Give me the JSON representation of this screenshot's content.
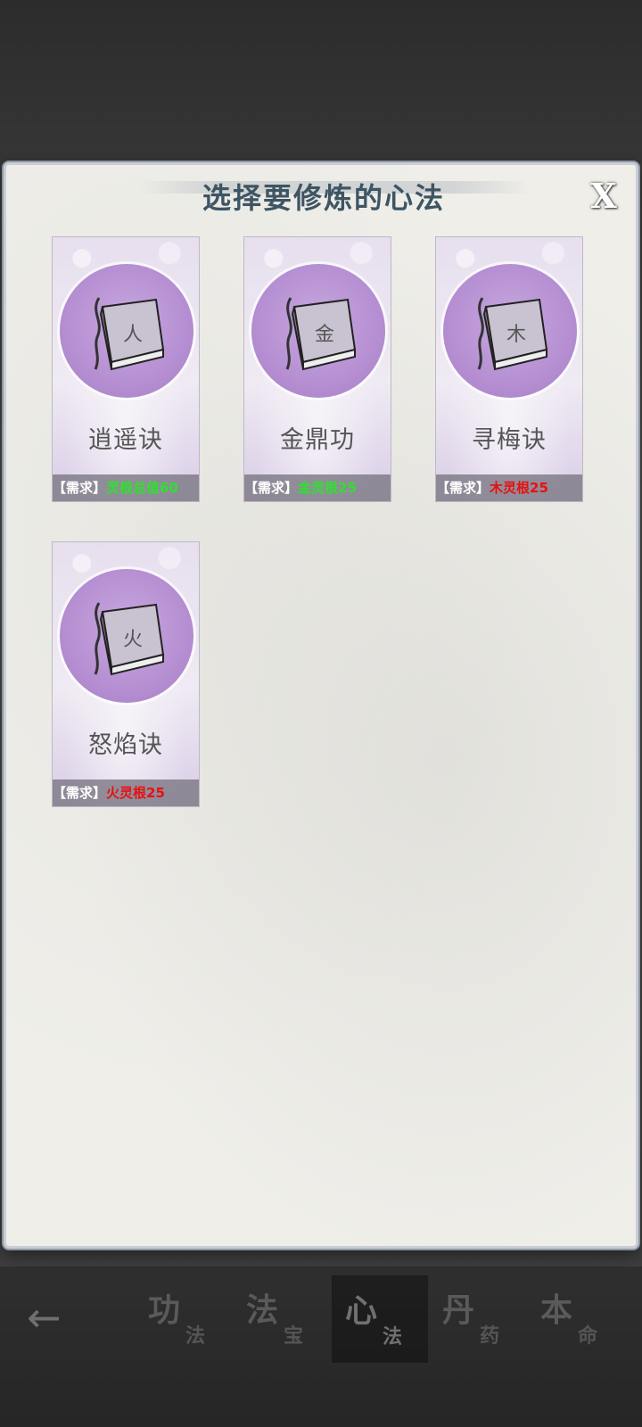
{
  "dialog": {
    "title": "选择要修炼的心法",
    "close_label": "X"
  },
  "cards": [
    {
      "name": "逍遥诀",
      "req_tag": "【需求】",
      "req_value": "灵根总值60",
      "req_color": "#2fe02f",
      "glyph": "人"
    },
    {
      "name": "金鼎功",
      "req_tag": "【需求】",
      "req_value": "金灵根25",
      "req_color": "#2fe02f",
      "glyph": "金"
    },
    {
      "name": "寻梅诀",
      "req_tag": "【需求】",
      "req_value": "木灵根25",
      "req_color": "#e81010",
      "glyph": "木"
    },
    {
      "name": "怒焰诀",
      "req_tag": "【需求】",
      "req_value": "火灵根25",
      "req_color": "#e81010",
      "glyph": "火"
    }
  ],
  "nav": {
    "back_icon": "back-arrow-icon",
    "tabs": [
      {
        "big": "功",
        "small": "法",
        "active": false
      },
      {
        "big": "法",
        "small": "宝",
        "active": false
      },
      {
        "big": "心",
        "small": "法",
        "active": true
      },
      {
        "big": "丹",
        "small": "药",
        "active": false
      },
      {
        "big": "本",
        "small": "命",
        "active": false
      }
    ]
  }
}
